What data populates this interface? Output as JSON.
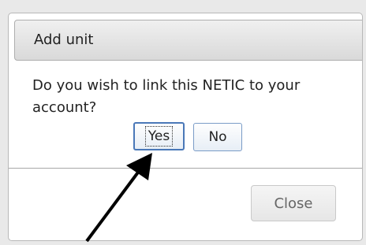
{
  "dialog": {
    "title": "Add unit",
    "message": "Do you wish to link this NETIC to your account?",
    "yes_label": "Yes",
    "no_label": "No",
    "close_label": "Close"
  },
  "icons": {
    "annotation": "arrow-icon"
  },
  "colors": {
    "accent": "#4a78b8",
    "arrow": "#000000"
  }
}
